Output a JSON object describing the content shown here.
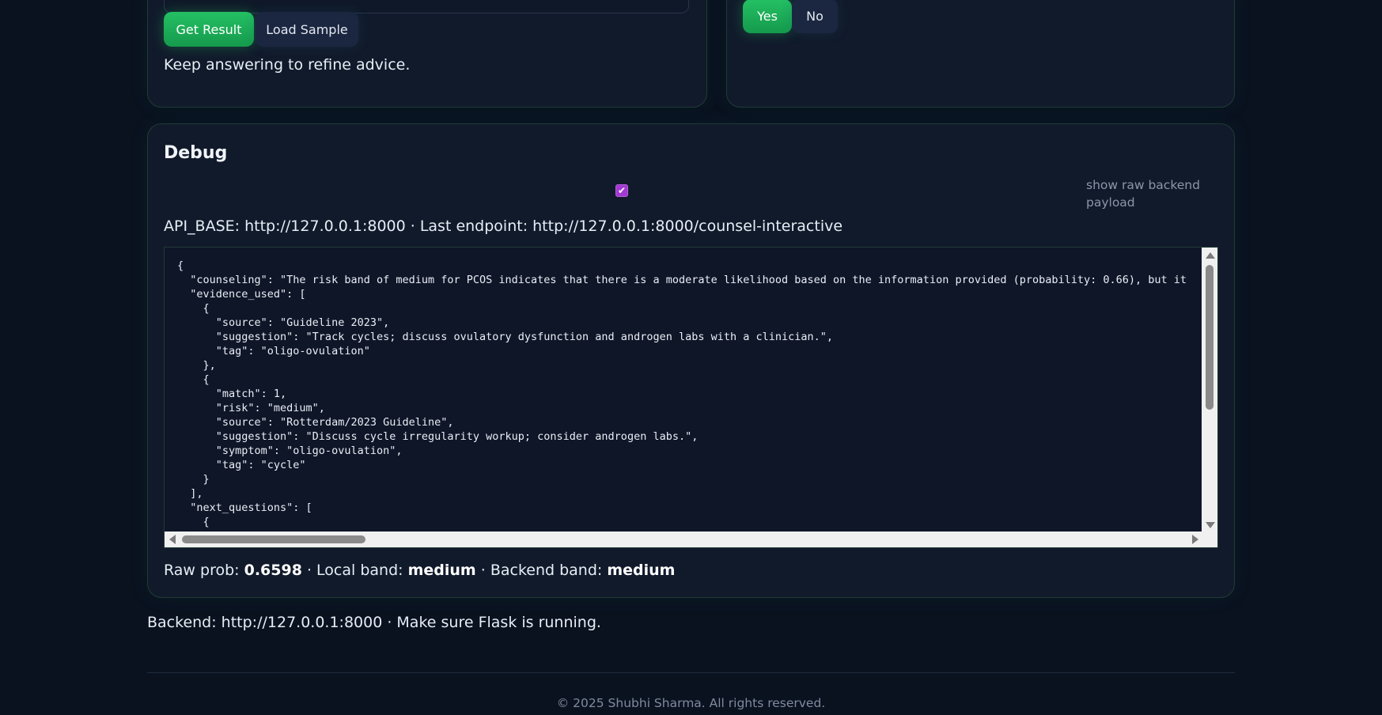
{
  "question_panel": {
    "get_result_label": "Get Result",
    "load_sample_label": "Load Sample",
    "hint": "Keep answering to refine advice."
  },
  "answer_panel": {
    "yes_label": "Yes",
    "no_label": "No"
  },
  "debug": {
    "title": "Debug",
    "raw_payload_checked": true,
    "raw_payload_label": "show raw backend payload",
    "endpoint_text": "API_BASE: http://127.0.0.1:8000 · Last endpoint: http://127.0.0.1:8000/counsel-interactive",
    "payload_text": "{\n  \"counseling\": \"The risk band of medium for PCOS indicates that there is a moderate likelihood based on the information provided (probability: 0.66), but it\n  \"evidence_used\": [\n    {\n      \"source\": \"Guideline 2023\",\n      \"suggestion\": \"Track cycles; discuss ovulatory dysfunction and androgen labs with a clinician.\",\n      \"tag\": \"oligo-ovulation\"\n    },\n    {\n      \"match\": 1,\n      \"risk\": \"medium\",\n      \"source\": \"Rotterdam/2023 Guideline\",\n      \"suggestion\": \"Discuss cycle irregularity workup; consider androgen labs.\",\n      \"symptom\": \"oligo-ovulation\",\n      \"tag\": \"cycle\"\n    }\n  ],\n  \"next_questions\": [\n    {",
    "stats": {
      "raw_prob_label": "Raw prob: ",
      "raw_prob_value": "0.6598",
      "local_band_label": " · Local band: ",
      "local_band_value": "medium",
      "backend_band_label": " · Backend band: ",
      "backend_band_value": "medium"
    }
  },
  "backend_note": "Backend: http://127.0.0.1:8000 · Make sure Flask is running.",
  "footer": "© 2025 Shubhi Sharma. All rights reserved.",
  "colors": {
    "page_bg": "#0a1220",
    "panel_bg": "#111a2b",
    "accent_green": "#22c55e",
    "checkbox_purple": "#a03ad0"
  }
}
